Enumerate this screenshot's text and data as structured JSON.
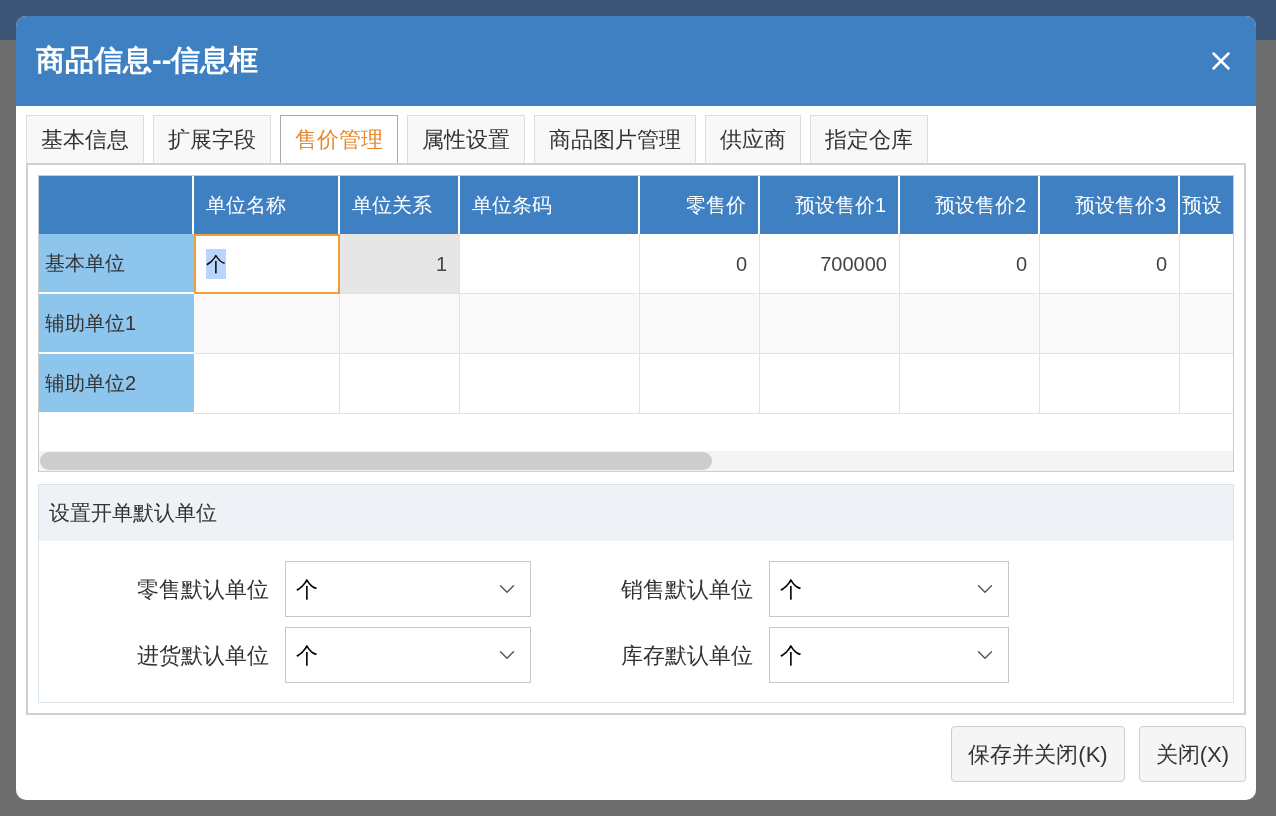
{
  "dialog": {
    "title": "商品信息--信息框"
  },
  "tabs": [
    {
      "label": "基本信息",
      "selected": false
    },
    {
      "label": "扩展字段",
      "selected": false
    },
    {
      "label": "售价管理",
      "selected": true
    },
    {
      "label": "属性设置",
      "selected": false
    },
    {
      "label": "商品图片管理",
      "selected": false
    },
    {
      "label": "供应商",
      "selected": false
    },
    {
      "label": "指定仓库",
      "selected": false
    }
  ],
  "table": {
    "columns": [
      {
        "label": "单位名称",
        "kind": "text"
      },
      {
        "label": "单位关系",
        "kind": "number"
      },
      {
        "label": "单位条码",
        "kind": "text"
      },
      {
        "label": "零售价",
        "kind": "number"
      },
      {
        "label": "预设售价1",
        "kind": "number"
      },
      {
        "label": "预设售价2",
        "kind": "number"
      },
      {
        "label": "预设售价3",
        "kind": "number"
      },
      {
        "label": "预设",
        "kind": "number"
      }
    ],
    "rows": [
      {
        "label": "基本单位",
        "cells": [
          {
            "text": "个",
            "focused": true,
            "readonly": false
          },
          {
            "text": "1",
            "focused": false,
            "readonly": true
          },
          null,
          {
            "text": "0",
            "focused": false,
            "readonly": false
          },
          {
            "text": "700000",
            "focused": false,
            "readonly": false
          },
          {
            "text": "0",
            "focused": false,
            "readonly": false
          },
          {
            "text": "0",
            "focused": false,
            "readonly": false
          }
        ]
      },
      {
        "label": "辅助单位1"
      },
      {
        "label": "辅助单位2"
      }
    ]
  },
  "default_units": {
    "title": "设置开单默认单位",
    "fields": [
      {
        "label": "零售默认单位",
        "value": "个"
      },
      {
        "label": "销售默认单位",
        "value": "个"
      },
      {
        "label": "进货默认单位",
        "value": "个"
      },
      {
        "label": "库存默认单位",
        "value": "个"
      }
    ]
  },
  "buttons": [
    {
      "label": "保存并关闭(K)"
    },
    {
      "label": "关闭(X)"
    }
  ]
}
